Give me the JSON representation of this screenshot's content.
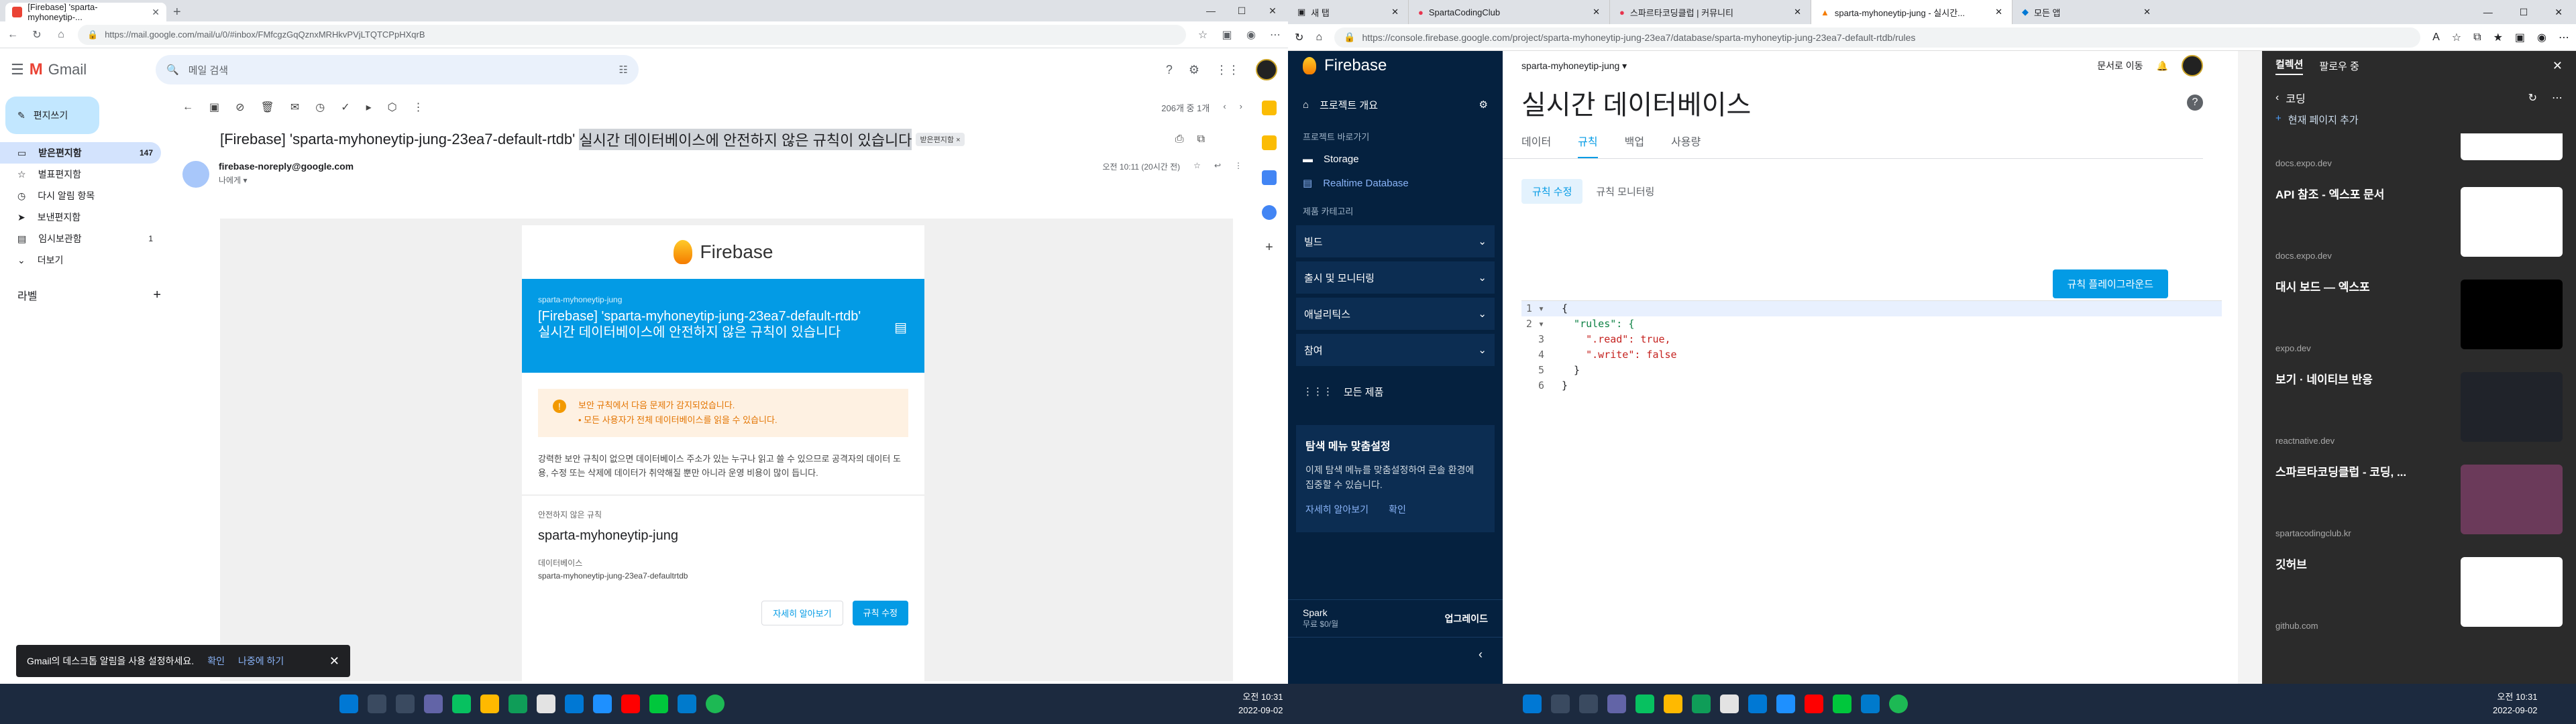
{
  "left": {
    "tab_title": "[Firebase] 'sparta-myhoneytip-...",
    "url": "https://mail.google.com/mail/u/0/#inbox/FMfcgzGqQznxMRHkvPVjLTQTCPpHXqrB",
    "gmail": {
      "brand": "Gmail",
      "search_placeholder": "메일 검색",
      "compose": "편지쓰기",
      "nav": [
        {
          "label": "받은편지함",
          "count": "147"
        },
        {
          "label": "별표편지함",
          "count": ""
        },
        {
          "label": "다시 알림 항목",
          "count": ""
        },
        {
          "label": "보낸편지함",
          "count": ""
        },
        {
          "label": "임시보관함",
          "count": "1"
        },
        {
          "label": "더보기",
          "count": ""
        }
      ],
      "labels_title": "라벨",
      "pager": "206개 중 1개",
      "subject": "[Firebase] 'sparta-myhoneytip-jung-23ea7-default-rtdb'",
      "subject_hl": "실시간 데이터베이스에 안전하지 않은 규칙이 있습니다",
      "tag": "받은편지함 ×",
      "sender": "firebase-noreply@google.com",
      "to_me": "나에게 ▾",
      "time": "오전 10:11 (20시간 전)"
    },
    "email": {
      "brand": "Firebase",
      "banner_project": "sparta-myhoneytip-jung",
      "banner_title": "[Firebase] 'sparta-myhoneytip-jung-23ea7-default-rtdb' 실시간 데이터베이스에 안전하지 않은 규칙이 있습니다",
      "warn1": "보안 규칙에서 다음 문제가 감지되었습니다.",
      "warn2": "• 모든 사용자가 전체 데이터베이스를 읽을 수 있습니다.",
      "para": "강력한 보안 규칙이 없으면 데이터베이스 주소가 있는 누구나 읽고 쓸 수 있으므로 공격자의 데이터 도용, 수정 또는 삭제에 데이터가 취약해질 뿐만 아니라 운영 비용이 많이 듭니다.",
      "sec_label": "안전하지 않은 규칙",
      "project_name": "sparta-myhoneytip-jung",
      "db_label": "데이터베이스",
      "db_value": "sparta-myhoneytip-jung-23ea7-defaultrtdb",
      "btn_learn": "자세히 알아보기",
      "btn_edit": "규칙 수정"
    },
    "snackbar": {
      "text": "Gmail의 데스크톱 알림을 사용 설정하세요.",
      "ok": "확인",
      "later": "나중에 하기"
    }
  },
  "right": {
    "tabs": [
      "새 탭",
      "SpartaCodingClub",
      "스파르타코딩클럽 | 커뮤니티",
      "sparta-myhoneytip-jung - 실시간...",
      "모든 앱"
    ],
    "url": "https://console.firebase.google.com/project/sparta-myhoneytip-jung-23ea7/database/sparta-myhoneytip-jung-23ea7-default-rtdb/rules",
    "firebase": {
      "brand": "Firebase",
      "overview": "프로젝트 개요",
      "shortcut_cat": "프로젝트 바로가기",
      "storage": "Storage",
      "rtdb": "Realtime Database",
      "product_cat": "제품 카테고리",
      "groups": [
        "빌드",
        "출시 및 모니터링",
        "애널리틱스",
        "참여"
      ],
      "all_products": "모든 제품",
      "promo_title": "탐색 메뉴 맞춤설정",
      "promo_desc": "이제 탐색 메뉴를 맞춤설정하여 콘솔 환경에 집중할 수 있습니다.",
      "promo_learn": "자세히 알아보기",
      "promo_ok": "확인",
      "plan": "Spark",
      "plan_sub": "무료 $0/월",
      "upgrade": "업그레이드",
      "project_select": "sparta-myhoneytip-jung ▾",
      "docs": "문서로 이동",
      "page_title": "실시간 데이터베이스",
      "tabs": [
        "데이터",
        "규칙",
        "백업",
        "사용량"
      ],
      "subtabs": [
        "규칙 수정",
        "규칙 모니터링"
      ],
      "playground": "규칙 플레이그라운드",
      "code": [
        {
          "n": "1 ▾",
          "t": "{"
        },
        {
          "n": "2 ▾",
          "t": "  \"rules\": {"
        },
        {
          "n": "3",
          "t": "    \".read\": true,"
        },
        {
          "n": "4",
          "t": "    \".write\": false"
        },
        {
          "n": "5",
          "t": "  }"
        },
        {
          "n": "6",
          "t": "}"
        }
      ]
    },
    "edge": {
      "tabs": [
        "컬렉션",
        "팔로우 중"
      ],
      "folder": "코딩",
      "add": "현재 페이지 추가",
      "items": [
        {
          "title": "",
          "domain": "docs.expo.dev",
          "color": "#ffffff"
        },
        {
          "title": "API 참조 - 엑스포 문서",
          "domain": "docs.expo.dev",
          "color": "#ffffff"
        },
        {
          "title": "대시 보드 — 엑스포",
          "domain": "expo.dev",
          "color": "#000000"
        },
        {
          "title": "보기 · 네이티브 반응",
          "domain": "reactnative.dev",
          "color": "#20232a"
        },
        {
          "title": "스파르타코딩클럽 - 코딩, ...",
          "domain": "spartacodingclub.kr",
          "color": "#6b3a5a"
        },
        {
          "title": "깃허브",
          "domain": "github.com",
          "color": "#ffffff"
        }
      ]
    }
  },
  "taskbar": {
    "left_time": "오전 10:31",
    "left_date": "2022-09-02",
    "right_time": "오전 10:31",
    "right_date": "2022-09-02"
  }
}
